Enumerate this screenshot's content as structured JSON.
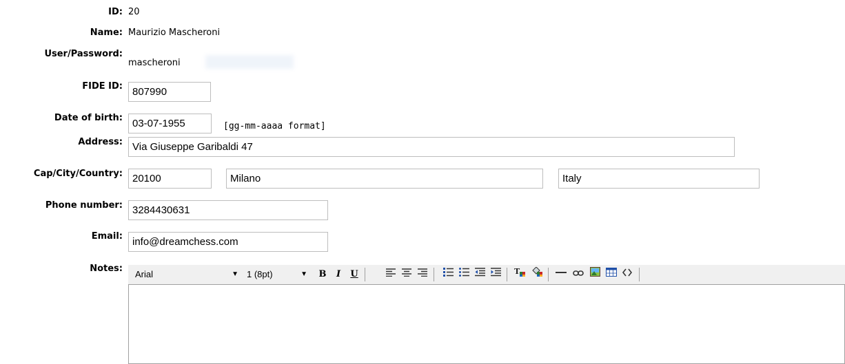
{
  "form": {
    "id": {
      "label": "ID:",
      "value": "20"
    },
    "name": {
      "label": "Name:",
      "value": "Maurizio Mascheroni"
    },
    "user_password": {
      "label": "User/Password:",
      "value": "mascheroni"
    },
    "fide_id": {
      "label": "FIDE ID:",
      "value": "807990"
    },
    "date_of_birth": {
      "label": "Date of birth:",
      "value": "03-07-1955",
      "hint": "[gg-mm-aaaa format]"
    },
    "address": {
      "label": "Address:",
      "value": "Via Giuseppe Garibaldi 47"
    },
    "cap_city_country": {
      "label": "Cap/City/Country:",
      "cap": "20100",
      "city": "Milano",
      "country": "Italy"
    },
    "phone": {
      "label": "Phone number:",
      "value": "3284430631"
    },
    "email": {
      "label": "Email:",
      "value": "info@dreamchess.com"
    },
    "notes": {
      "label": "Notes:"
    }
  },
  "editor": {
    "font_select": "Arial",
    "size_select": "1 (8pt)",
    "bold": "B",
    "italic": "I",
    "underline": "U",
    "icons": [
      "align-left-icon",
      "align-center-icon",
      "align-right-icon",
      "ordered-list-icon",
      "unordered-list-icon",
      "outdent-icon",
      "indent-icon",
      "text-color-icon",
      "background-color-icon",
      "horizontal-rule-icon",
      "link-icon",
      "image-icon",
      "table-icon",
      "source-code-icon"
    ]
  }
}
